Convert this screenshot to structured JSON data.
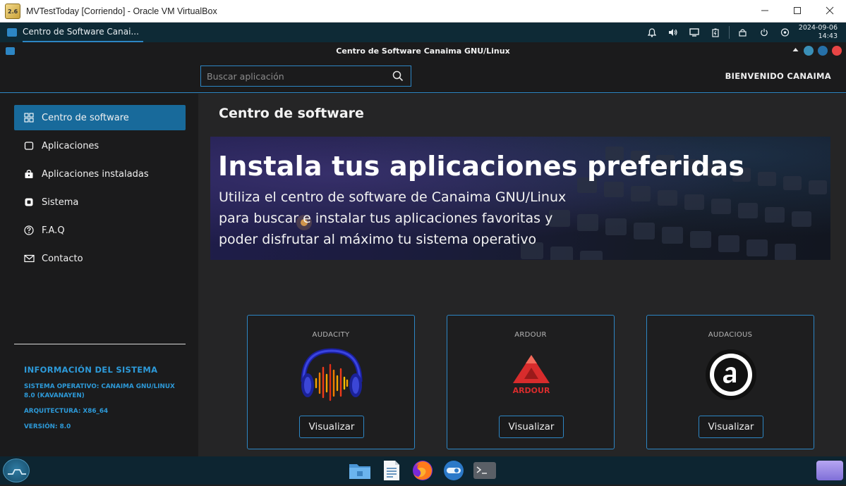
{
  "host": {
    "title": "MVTestToday [Corriendo] - Oracle VM VirtualBox",
    "icon_text": "2.6",
    "controls": [
      "minimize-icon",
      "maximize-icon",
      "close-icon"
    ]
  },
  "panel": {
    "task_label": "Centro de Software Canai...",
    "tray_icons": [
      "bell-icon",
      "volume-icon",
      "display-icon",
      "battery-icon",
      "lock-icon",
      "power-icon",
      "eye-icon"
    ],
    "date": "2024-09-06",
    "time": "14:43"
  },
  "window": {
    "title": "Centro de Software Canaima GNU/Linux",
    "control_colors": [
      "#3a8fb7",
      "#2670a8",
      "#e84545"
    ]
  },
  "header": {
    "search_placeholder": "Buscar aplicación",
    "welcome": "BIENVENIDO CANAIMA"
  },
  "sidebar": {
    "items": [
      {
        "label": "Centro de software",
        "icon": "grid-icon",
        "active": true
      },
      {
        "label": "Aplicaciones",
        "icon": "square-icon",
        "active": false
      },
      {
        "label": "Aplicaciones instaladas",
        "icon": "lock-bag-icon",
        "active": false
      },
      {
        "label": "Sistema",
        "icon": "chip-icon",
        "active": false
      },
      {
        "label": "F.A.Q",
        "icon": "question-icon",
        "active": false
      },
      {
        "label": "Contacto",
        "icon": "mail-icon",
        "active": false
      }
    ],
    "info_title": "INFORMACIÓN DEL SISTEMA",
    "info_lines": [
      "SISTEMA OPERATIVO: CANAIMA GNU/LINUX 8.0 (KAVANAYEN)",
      "ARQUITECTURA: X86_64",
      "VERSIÓN: 8.0"
    ]
  },
  "main": {
    "title": "Centro de software",
    "banner": {
      "heading": "Instala tus aplicaciones preferidas",
      "lines": [
        "Utiliza el centro de software de Canaima GNU/Linux",
        "para buscar e instalar tus aplicaciones favoritas y",
        "poder disfrutar al máximo tu sistema operativo"
      ]
    },
    "cards": [
      {
        "name": "AUDACITY",
        "button": "Visualizar",
        "logo": "audacity-logo",
        "logo_text": ""
      },
      {
        "name": "ARDOUR",
        "button": "Visualizar",
        "logo": "ardour-logo",
        "logo_text": "ARDOUR"
      },
      {
        "name": "AUDACIOUS",
        "button": "Visualizar",
        "logo": "audacious-logo",
        "logo_text": ""
      }
    ]
  },
  "dock": {
    "apps": [
      "files-icon",
      "text-editor-icon",
      "firefox-icon",
      "toggle-app-icon",
      "terminal-icon"
    ]
  }
}
